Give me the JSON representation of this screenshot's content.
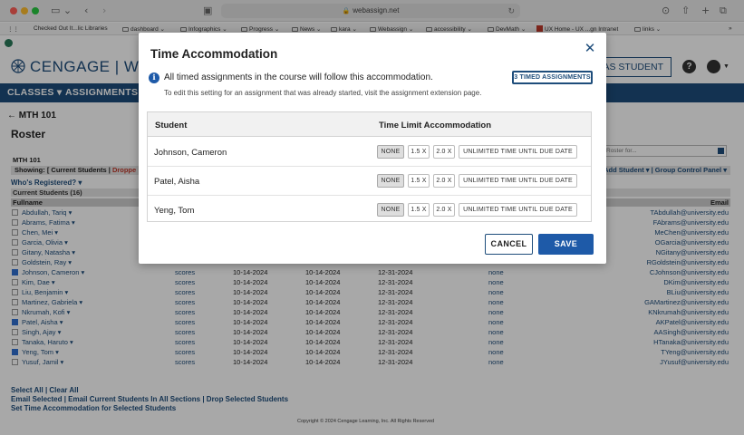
{
  "browser": {
    "address": "webassign.net",
    "bookmarks": [
      {
        "label": "Checked Out It...lic Libraries"
      },
      {
        "label": "dashboard ⌄"
      },
      {
        "label": "Infographics ⌄"
      },
      {
        "label": "Progress ⌄"
      },
      {
        "label": "News ⌄"
      },
      {
        "label": "kara ⌄"
      },
      {
        "label": "Webassign ⌄"
      },
      {
        "label": "accessibility ⌄"
      },
      {
        "label": "DevMath ⌄"
      },
      {
        "label": "UX Home - UX ...gn Intranet"
      },
      {
        "label": "links ⌄"
      }
    ]
  },
  "header": {
    "logo_text": "CENGAGE | WEB",
    "view_as_student": "W AS STUDENT",
    "help": "?"
  },
  "nav": {
    "classes": "CLASSES ▾",
    "assignments": "ASSIGNMENTS ▾"
  },
  "page": {
    "course_line": "← MTH 101",
    "roster_title": "Roster",
    "roster_search_placeholder": "Roster for...",
    "course_sub": "MTH 101",
    "showing_prefix": "Showing: [ Current Students |",
    "showing_dropped": "Droppe",
    "showing_right": "| Add Student ▾ | Group Control Panel ▾",
    "whos_registered": "Who's Registered? ▾",
    "current_students": "Current Students (16)",
    "col_fullname": "Fullname",
    "col_email": "Email",
    "students": [
      {
        "name": "Abdullah, Tariq ▾",
        "checked": false,
        "scores": "",
        "d1": "",
        "d2": "",
        "d3": "",
        "status": "",
        "email": "TAbdullah@university.edu"
      },
      {
        "name": "Abrams, Fatima ▾",
        "checked": false,
        "scores": "",
        "d1": "",
        "d2": "",
        "d3": "",
        "status": "",
        "email": "FAbrams@university.edu"
      },
      {
        "name": "Chen, Mei ▾",
        "checked": false,
        "scores": "",
        "d1": "",
        "d2": "",
        "d3": "",
        "status": "",
        "email": "MeChen@university.edu"
      },
      {
        "name": "Garcia, Olivia ▾",
        "checked": false,
        "scores": "",
        "d1": "",
        "d2": "",
        "d3": "",
        "status": "",
        "email": "OGarcia@university.edu"
      },
      {
        "name": "Gitany, Natasha ▾",
        "checked": false,
        "scores": "",
        "d1": "",
        "d2": "",
        "d3": "",
        "status": "",
        "email": "NGitany@university.edu"
      },
      {
        "name": "Goldstein, Ray ▾",
        "checked": false,
        "scores": "",
        "d1": "",
        "d2": "",
        "d3": "",
        "status": "",
        "email": "RGoldstein@university.edu"
      },
      {
        "name": "Johnson, Cameron ▾",
        "checked": true,
        "scores": "scores",
        "d1": "10-14-2024",
        "d2": "10-14-2024",
        "d3": "12-31-2024",
        "status": "none",
        "email": "CJohnson@university.edu"
      },
      {
        "name": "Kim, Dae ▾",
        "checked": false,
        "scores": "scores",
        "d1": "10-14-2024",
        "d2": "10-14-2024",
        "d3": "12-31-2024",
        "status": "none",
        "email": "DKim@university.edu"
      },
      {
        "name": "Liu, Benjamin ▾",
        "checked": false,
        "scores": "scores",
        "d1": "10-14-2024",
        "d2": "10-14-2024",
        "d3": "12-31-2024",
        "status": "none",
        "email": "BLiu@university.edu"
      },
      {
        "name": "Martinez, Gabriela ▾",
        "checked": false,
        "scores": "scores",
        "d1": "10-14-2024",
        "d2": "10-14-2024",
        "d3": "12-31-2024",
        "status": "none",
        "email": "GAMartinez@university.edu"
      },
      {
        "name": "Nkrumah, Kofi ▾",
        "checked": false,
        "scores": "scores",
        "d1": "10-14-2024",
        "d2": "10-14-2024",
        "d3": "12-31-2024",
        "status": "none",
        "email": "KNkrumah@university.edu"
      },
      {
        "name": "Patel, Aisha ▾",
        "checked": true,
        "scores": "scores",
        "d1": "10-14-2024",
        "d2": "10-14-2024",
        "d3": "12-31-2024",
        "status": "none",
        "email": "AKPatel@university.edu"
      },
      {
        "name": "Singh, Ajay ▾",
        "checked": false,
        "scores": "scores",
        "d1": "10-14-2024",
        "d2": "10-14-2024",
        "d3": "12-31-2024",
        "status": "none",
        "email": "AASingh@university.edu"
      },
      {
        "name": "Tanaka, Haruto ▾",
        "checked": false,
        "scores": "scores",
        "d1": "10-14-2024",
        "d2": "10-14-2024",
        "d3": "12-31-2024",
        "status": "none",
        "email": "HTanaka@university.edu"
      },
      {
        "name": "Yeng, Tom ▾",
        "checked": true,
        "scores": "scores",
        "d1": "10-14-2024",
        "d2": "10-14-2024",
        "d3": "12-31-2024",
        "status": "none",
        "email": "TYeng@university.edu"
      },
      {
        "name": "Yusuf, Jamil ▾",
        "checked": false,
        "scores": "scores",
        "d1": "10-14-2024",
        "d2": "10-14-2024",
        "d3": "12-31-2024",
        "status": "none",
        "email": "JYusuf@university.edu"
      }
    ],
    "select_all": "Select All | Clear All",
    "email_links": "Email Selected | Email Current Students In All Sections | Drop Selected Students",
    "set_time": "Set Time Accommodation for Selected Students",
    "footer": "Copyright © 2024 Cengage Learning, Inc. All Rights Reserved"
  },
  "modal": {
    "title": "Time Accommodation",
    "info_main": "All timed assignments in the course will follow this accommodation.",
    "info_sub": "To edit this setting for an assignment that was already started, visit the assignment extension page.",
    "timed_button": "3 TIMED ASSIGNMENTS",
    "col_student": "Student",
    "col_limit": "Time Limit Accommodation",
    "options": {
      "none": "NONE",
      "x15": "1.5 X",
      "x20": "2.0 X",
      "unlimited": "UNLIMITED TIME UNTIL DUE DATE"
    },
    "rows": [
      {
        "student": "Johnson, Cameron",
        "selected": "none"
      },
      {
        "student": "Patel, Aisha",
        "selected": "none"
      },
      {
        "student": "Yeng, Tom",
        "selected": "none"
      }
    ],
    "cancel": "CANCEL",
    "save": "SAVE"
  },
  "colors": {
    "brand": "#1e4d7b",
    "primary_button": "#1e5aa8",
    "link": "#1e4d7b"
  }
}
